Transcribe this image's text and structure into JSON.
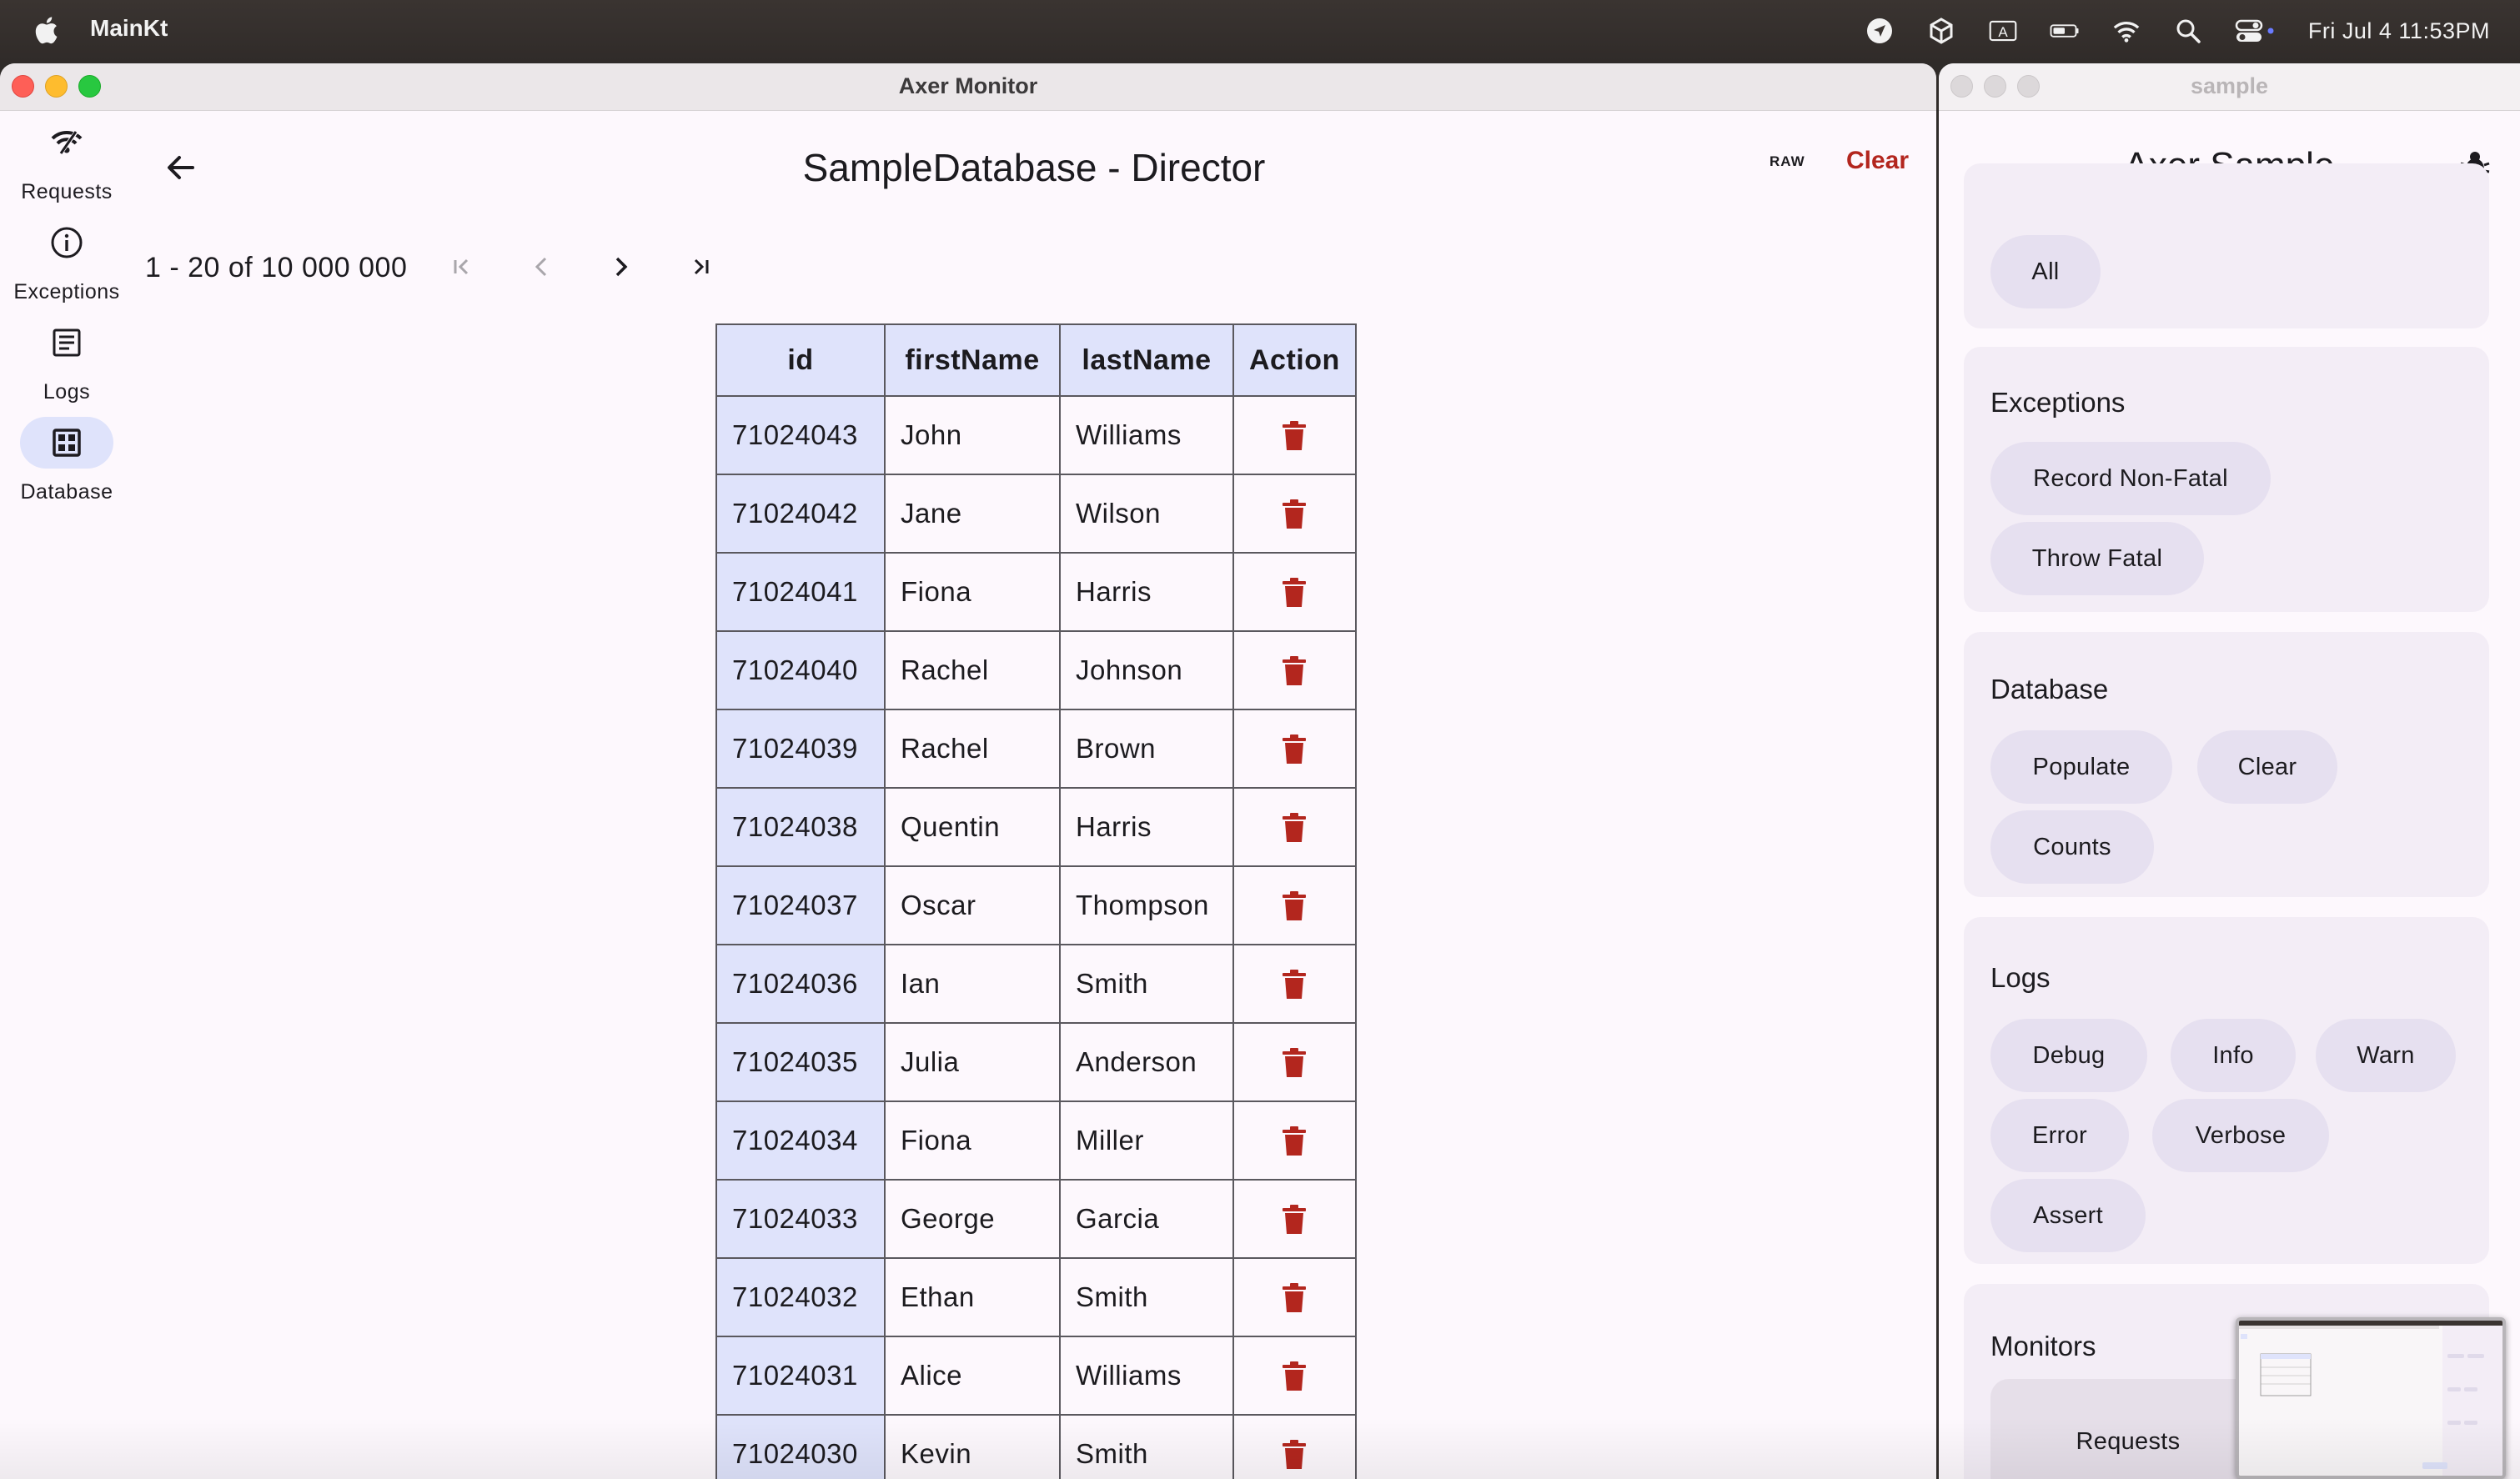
{
  "menubar": {
    "app_name": "MainKt",
    "clock": "Fri Jul 4  11:53PM",
    "icons": [
      "location-arrow-icon",
      "cube-icon",
      "keyboard-a-icon",
      "battery-icon",
      "wifi-icon",
      "spotlight-search-icon",
      "control-center-icon"
    ]
  },
  "main_window": {
    "title": "Axer Monitor",
    "nav": [
      {
        "label": "Requests",
        "icon": "wifi-signal-icon"
      },
      {
        "label": "Exceptions",
        "icon": "info-icon"
      },
      {
        "label": "Logs",
        "icon": "document-icon"
      },
      {
        "label": "Database",
        "icon": "grid-icon"
      }
    ],
    "page_title": "SampleDatabase - Director",
    "raw_label": "RAW",
    "clear_label": "Clear",
    "pager": "1 - 20 of 10 000 000",
    "table": {
      "headers": [
        "id",
        "firstName",
        "lastName",
        "Action"
      ],
      "rows": [
        [
          "71024043",
          "John",
          "Williams"
        ],
        [
          "71024042",
          "Jane",
          "Wilson"
        ],
        [
          "71024041",
          "Fiona",
          "Harris"
        ],
        [
          "71024040",
          "Rachel",
          "Johnson"
        ],
        [
          "71024039",
          "Rachel",
          "Brown"
        ],
        [
          "71024038",
          "Quentin",
          "Harris"
        ],
        [
          "71024037",
          "Oscar",
          "Thompson"
        ],
        [
          "71024036",
          "Ian",
          "Smith"
        ],
        [
          "71024035",
          "Julia",
          "Anderson"
        ],
        [
          "71024034",
          "Fiona",
          "Miller"
        ],
        [
          "71024033",
          "George",
          "Garcia"
        ],
        [
          "71024032",
          "Ethan",
          "Smith"
        ],
        [
          "71024031",
          "Alice",
          "Williams"
        ],
        [
          "71024030",
          "Kevin",
          "Smith"
        ]
      ]
    },
    "colors": {
      "accent_bg": "#dfe3fb",
      "danger": "#b3261e"
    }
  },
  "side_window": {
    "title": "sample",
    "app_title": "Axer Sample",
    "top_chip": "All",
    "sections": {
      "exceptions": {
        "title": "Exceptions",
        "chips": [
          "Record Non-Fatal",
          "Throw Fatal"
        ]
      },
      "database": {
        "title": "Database",
        "chips": [
          "Populate",
          "Clear",
          "Counts"
        ]
      },
      "logs": {
        "title": "Logs",
        "chips": [
          "Debug",
          "Info",
          "Warn",
          "Error",
          "Verbose",
          "Assert"
        ]
      },
      "monitors": {
        "title": "Monitors",
        "chips": [
          "Requests"
        ]
      }
    },
    "chip_color": "#e6e0f0"
  }
}
